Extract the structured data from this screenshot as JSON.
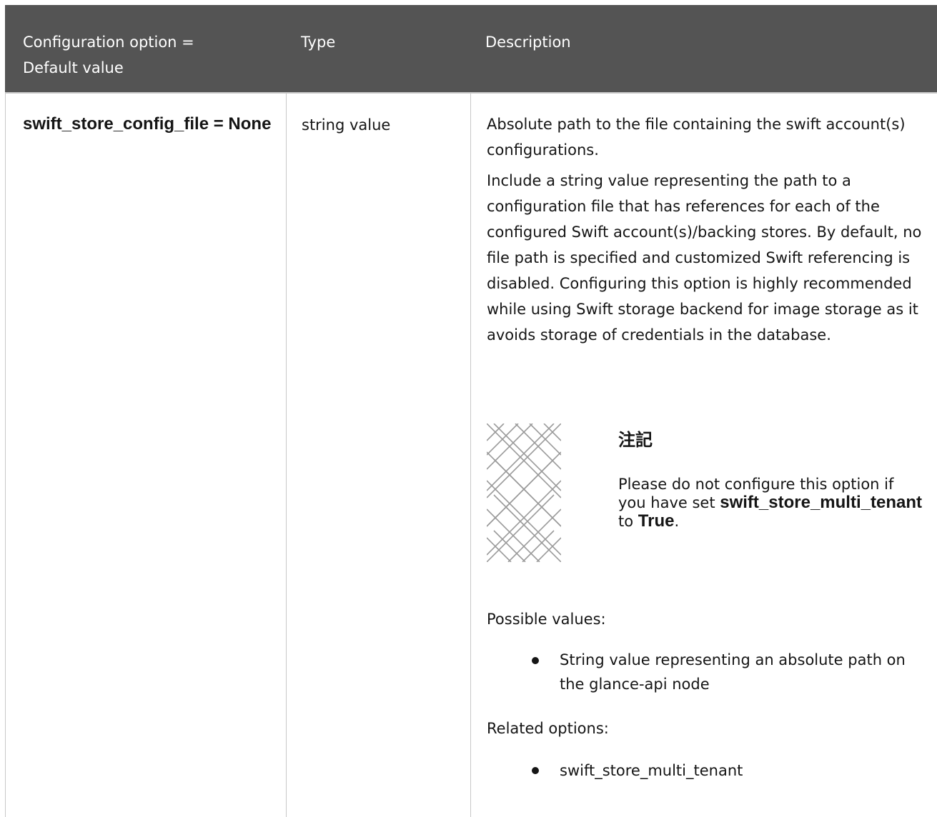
{
  "table": {
    "headers": [
      "Configuration option = Default value",
      "Type",
      "Description"
    ],
    "rows": [
      {
        "option": "swift_store_config_file = None",
        "type": "string value",
        "description": {
          "paragraphs": [
            "Absolute path to the file containing the swift account(s) configurations.",
            "Include a string value representing the path to a configuration file that has references for each of the configured Swift account(s)/backing stores. By default, no file path is specified and customized Swift referencing is disabled. Configuring this option is highly recommended while using Swift storage backend for image storage as it avoids storage of credentials in the database."
          ],
          "note": {
            "icon": "note-pattern-icon",
            "title": "注記",
            "text_before": "Please do not configure this option if you have set",
            "code1": "swift_store_multi_tenant",
            "text_middle": "to",
            "code2": "True",
            "text_after": "."
          },
          "possible_values_label": "Possible values:",
          "possible_values": [
            "String value representing an absolute path on the glance-api node"
          ],
          "related_options_label": "Related options:",
          "related_options": [
            "swift_store_multi_tenant"
          ]
        }
      }
    ]
  },
  "colors": {
    "header_bg": "#545454",
    "header_text": "#ffffff",
    "border": "#c8c8c8",
    "text": "#151515"
  }
}
